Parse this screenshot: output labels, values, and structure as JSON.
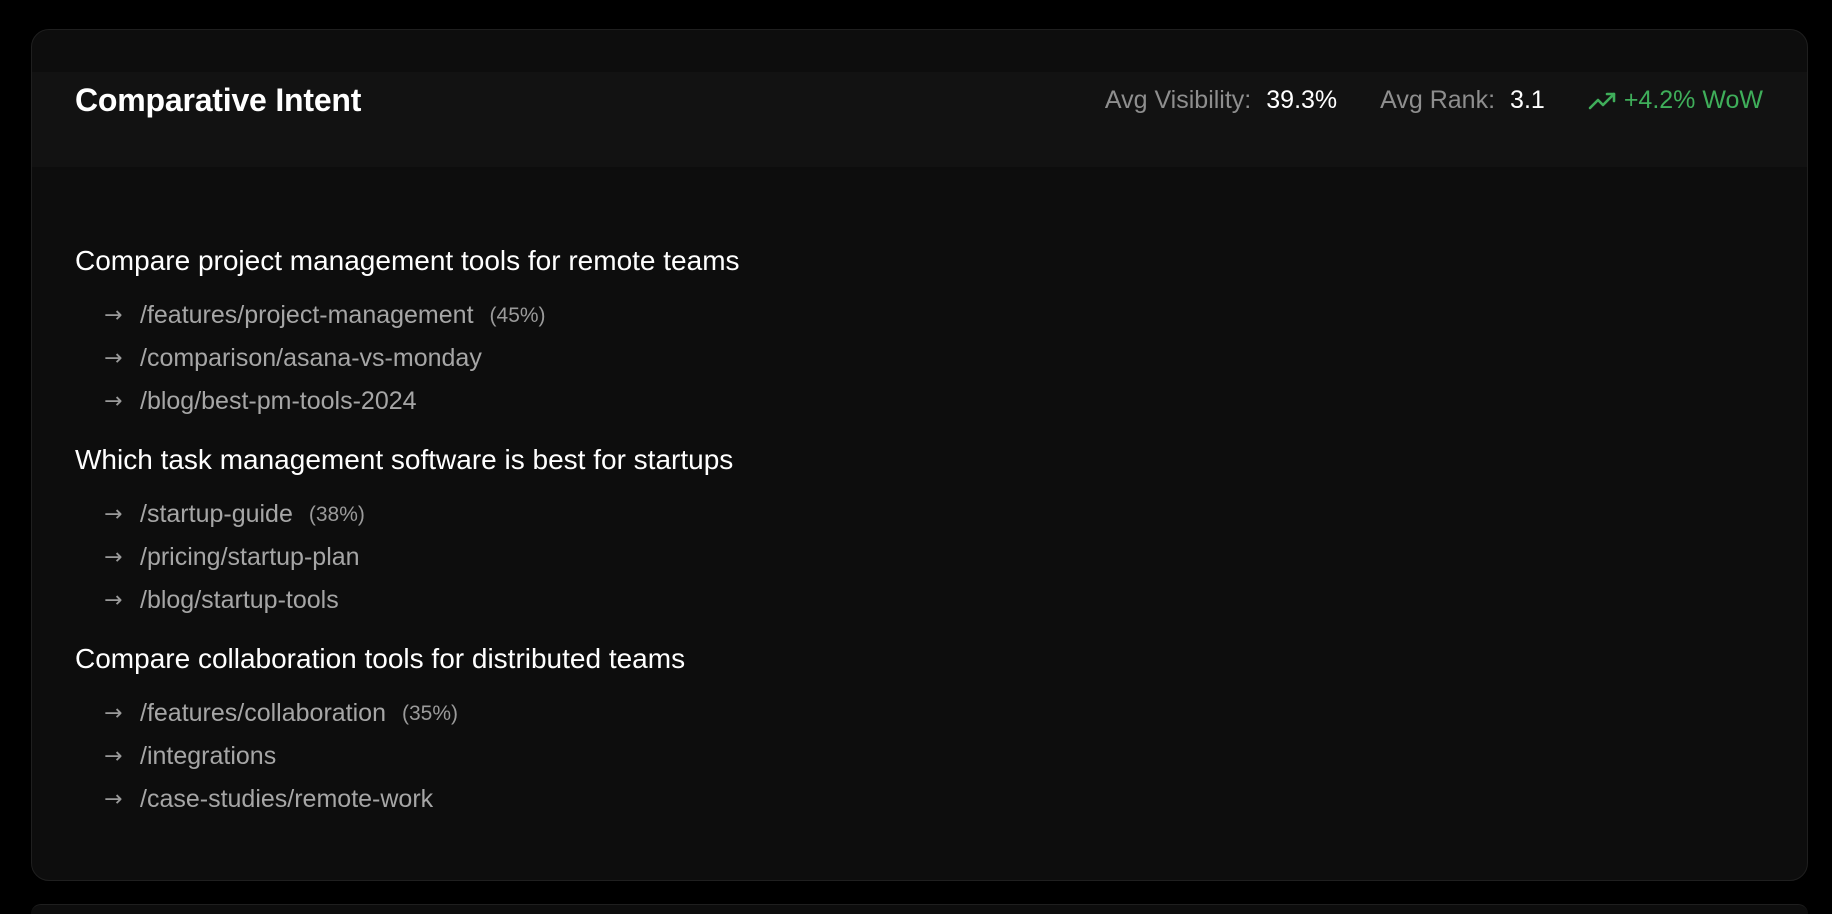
{
  "card": {
    "title": "Comparative Intent",
    "metrics": {
      "visibility_label": "Avg Visibility:",
      "visibility_value": "39.3%",
      "rank_label": "Avg Rank:",
      "rank_value": "3.1",
      "trend_text": "+4.2% WoW",
      "trend_icon": "trending-up-icon",
      "trend_color": "#3fae5a"
    }
  },
  "queries": [
    {
      "title": "Compare project management tools for remote teams",
      "pages": [
        {
          "path": "/features/project-management",
          "share": "(45%)"
        },
        {
          "path": "/comparison/asana-vs-monday",
          "share": ""
        },
        {
          "path": "/blog/best-pm-tools-2024",
          "share": ""
        }
      ]
    },
    {
      "title": "Which task management software is best for startups",
      "pages": [
        {
          "path": "/startup-guide",
          "share": "(38%)"
        },
        {
          "path": "/pricing/startup-plan",
          "share": ""
        },
        {
          "path": "/blog/startup-tools",
          "share": ""
        }
      ]
    },
    {
      "title": "Compare collaboration tools for distributed teams",
      "pages": [
        {
          "path": "/features/collaboration",
          "share": "(35%)"
        },
        {
          "path": "/integrations",
          "share": ""
        },
        {
          "path": "/case-studies/remote-work",
          "share": ""
        }
      ]
    }
  ]
}
